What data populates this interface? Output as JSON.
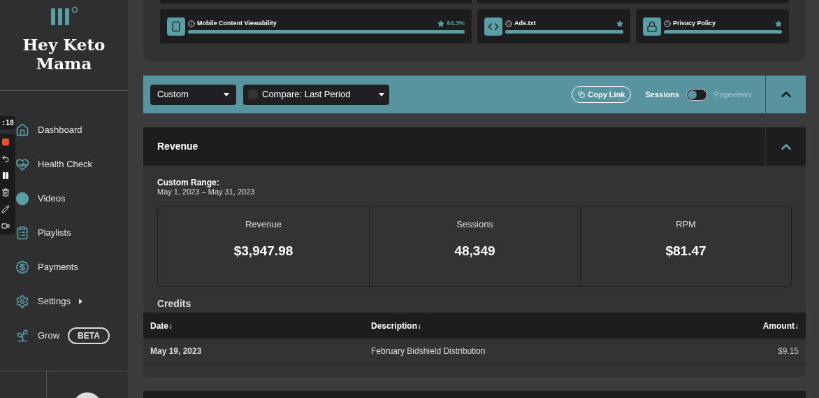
{
  "recorder": {
    "time": ":18"
  },
  "brand": {
    "name": "Hey Keto Mama"
  },
  "sidebar": {
    "items": [
      {
        "label": "Dashboard",
        "kind": "home"
      },
      {
        "label": "Health Check",
        "kind": "health"
      },
      {
        "label": "Videos",
        "kind": "videos"
      },
      {
        "label": "Playlists",
        "kind": "playlists"
      },
      {
        "label": "Payments",
        "kind": "payments"
      },
      {
        "label": "Settings",
        "kind": "settings",
        "expandable": true
      },
      {
        "label": "Grow",
        "kind": "grow",
        "badge": "BETA"
      }
    ]
  },
  "health_checks": [
    {
      "kind": "mobile",
      "label": "Mobile Content Viewability",
      "score": "64.3%",
      "level": 1
    },
    {
      "kind": "code",
      "label": "Ads.txt",
      "level": 1
    },
    {
      "kind": "lock",
      "label": "Privacy Policy",
      "level": 1
    }
  ],
  "toolbar": {
    "range": "Custom",
    "compare": {
      "label": "Compare: Last Period",
      "checked": false
    },
    "copy_link": "Copy Link",
    "metric_toggle": [
      {
        "label": "Sessions",
        "selected": true
      },
      {
        "label": "Pageviews",
        "selected": false
      }
    ]
  },
  "revenue": {
    "title": "Revenue",
    "expanded": true,
    "range_label": "Custom Range:",
    "range": "May 1, 2023 – May 31, 2023",
    "stats": [
      {
        "label": "Revenue",
        "value": "$3,947.98"
      },
      {
        "label": "Sessions",
        "value": "48,349"
      },
      {
        "label": "RPM",
        "value": "$81.47"
      }
    ],
    "credits": {
      "title": "Credits",
      "columns": [
        "Date↓",
        "Description↓",
        "Amount↓"
      ],
      "rows": [
        {
          "date": "May 19, 2023",
          "description": "February Bidshield Distribution",
          "amount": "$9.15"
        }
      ]
    }
  }
}
